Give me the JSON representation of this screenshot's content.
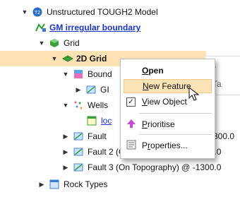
{
  "tree": {
    "root": {
      "label": "Unstructured TOUGH2 Model",
      "badge": "T2"
    },
    "boundary_link": {
      "label": "GM irregular boundary"
    },
    "grid": {
      "label": "Grid"
    },
    "grid2d": {
      "label": "2D Grid"
    },
    "boundaries": {
      "label": "Bound"
    },
    "gm_sub": {
      "label": "GI"
    },
    "wells": {
      "label": "Wells"
    },
    "loc": {
      "label": "loc"
    },
    "fault1": {
      "label": "Fault",
      "suffix": "300.0"
    },
    "fault2": {
      "label": "Fault 2 (On Topography) @ -1300.0"
    },
    "fault3": {
      "label": "Fault 3 (On Topography) @ -1300.0"
    },
    "rock_types": {
      "label": "Rock Types"
    }
  },
  "right_panel": {
    "text": "Ta"
  },
  "context_menu": {
    "items": [
      {
        "label": "Open",
        "underline": "O"
      },
      {
        "label": "New Feature",
        "underline": "N"
      },
      {
        "label": "View Object",
        "underline": "V",
        "checked": true
      },
      {
        "label": "Prioritise",
        "underline": "P"
      },
      {
        "label": "Properties...",
        "underline": "r"
      }
    ]
  },
  "colors": {
    "selection": "#fde3b4",
    "menu_highlight": "#fbe3b6",
    "link": "#1a35c8"
  }
}
